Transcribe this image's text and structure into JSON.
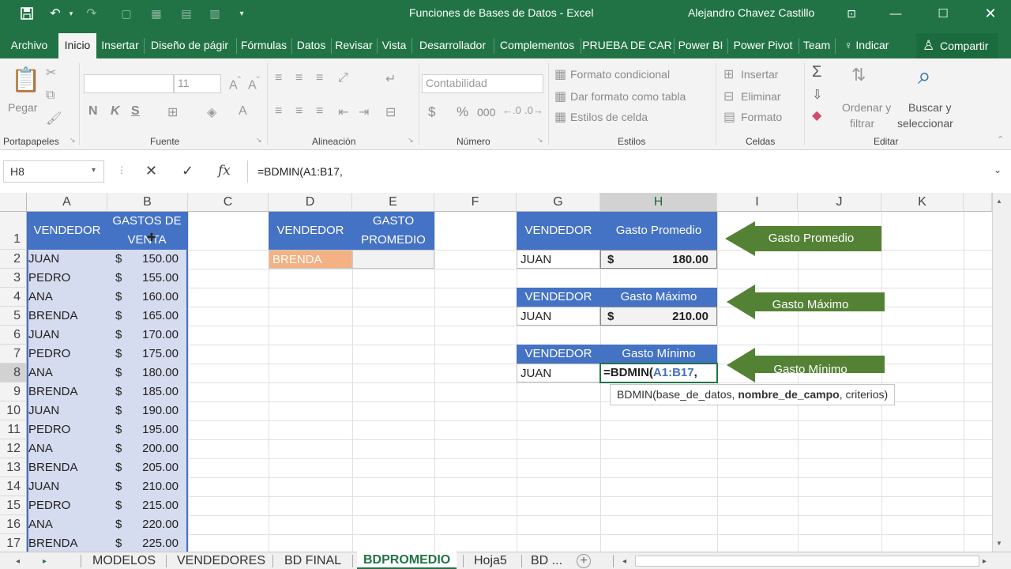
{
  "window": {
    "title": "Funciones de Bases de Datos - Excel",
    "user": "Alejandro Chavez Castillo",
    "accent": "#217346"
  },
  "tabs": [
    "Archivo",
    "Inicio",
    "Insertar",
    "Diseño de págir",
    "Fórmulas",
    "Datos",
    "Revisar",
    "Vista",
    "Desarrollador",
    "Complementos",
    "PRUEBA DE CAR",
    "Power BI",
    "Power Pivot",
    "Team"
  ],
  "tell_me": "Indicar",
  "share": "Compartir",
  "ribbon": {
    "paste": "Pegar",
    "font_size": "11",
    "bold": "N",
    "italic": "K",
    "underline": "S",
    "number_format": "Contabilidad",
    "currency": "$",
    "percent": "%",
    "thousands": "000",
    "conditional": "Formato condicional",
    "as_table": "Dar formato como tabla",
    "cell_styles": "Estilos de celda",
    "insert": "Insertar",
    "delete": "Eliminar",
    "format": "Formato",
    "sort_filter_1": "Ordenar y",
    "sort_filter_2": "filtrar",
    "find_1": "Buscar y",
    "find_2": "seleccionar",
    "groups": {
      "clipboard": "Portapapeles",
      "font": "Fuente",
      "alignment": "Alineación",
      "number": "Número",
      "styles": "Estilos",
      "cells": "Celdas",
      "editing": "Editar"
    }
  },
  "formula_bar": {
    "name_box": "H8",
    "cancel": "✕",
    "enter": "✓",
    "fx": "fx",
    "formula": "=BDMIN(A1:B17,"
  },
  "columns": [
    "A",
    "B",
    "C",
    "D",
    "E",
    "F",
    "G",
    "H",
    "I",
    "J",
    "K"
  ],
  "rows": [
    "1",
    "2",
    "3",
    "4",
    "5",
    "6",
    "7",
    "8",
    "9",
    "10",
    "11",
    "12",
    "13",
    "14",
    "15",
    "16",
    "17"
  ],
  "table": {
    "header_vendedor": "VENDEDOR",
    "header_gastos": "GASTOS DE VENTA",
    "currency": "$",
    "rows": [
      {
        "vendedor": "JUAN",
        "gasto": "150.00"
      },
      {
        "vendedor": "PEDRO",
        "gasto": "155.00"
      },
      {
        "vendedor": "ANA",
        "gasto": "160.00"
      },
      {
        "vendedor": "BRENDA",
        "gasto": "165.00"
      },
      {
        "vendedor": "JUAN",
        "gasto": "170.00"
      },
      {
        "vendedor": "PEDRO",
        "gasto": "175.00"
      },
      {
        "vendedor": "ANA",
        "gasto": "180.00"
      },
      {
        "vendedor": "BRENDA",
        "gasto": "185.00"
      },
      {
        "vendedor": "JUAN",
        "gasto": "190.00"
      },
      {
        "vendedor": "PEDRO",
        "gasto": "195.00"
      },
      {
        "vendedor": "ANA",
        "gasto": "200.00"
      },
      {
        "vendedor": "BRENDA",
        "gasto": "205.00"
      },
      {
        "vendedor": "JUAN",
        "gasto": "210.00"
      },
      {
        "vendedor": "PEDRO",
        "gasto": "215.00"
      },
      {
        "vendedor": "ANA",
        "gasto": "220.00"
      },
      {
        "vendedor": "BRENDA",
        "gasto": "225.00"
      }
    ]
  },
  "criteria_de": {
    "h_vendedor": "VENDEDOR",
    "h_gasto": "GASTO PROMEDIO",
    "vendedor": "BRENDA",
    "vendedor_fill": "#f4b183"
  },
  "blocks": {
    "vendedor_label": "VENDEDOR",
    "promedio_label": "Gasto Promedio",
    "promedio_vendedor": "JUAN",
    "promedio_valor": "180.00",
    "maximo_label": "Gasto Máximo",
    "maximo_vendedor": "JUAN",
    "maximo_valor": "210.00",
    "minimo_label": "Gasto Mínimo",
    "minimo_vendedor": "JUAN",
    "minimo_formula_prefix": "=BDMIN(",
    "minimo_formula_ref": "A1:B17",
    "minimo_formula_suffix": ","
  },
  "arrows": {
    "promedio": "Gasto Promedio",
    "maximo": "Gasto Máximo",
    "minimo": "Gasto Mínimo",
    "color": "#548235"
  },
  "tooltip": {
    "fn": "BDMIN(",
    "arg1": "base_de_datos",
    "sep1": ", ",
    "arg2": "nombre_de_campo",
    "sep2": ", ",
    "arg3": "criterios",
    "close": ")"
  },
  "sheets": [
    "MODELOS",
    "VENDEDORES",
    "BD FINAL",
    "BDPROMEDIO",
    "Hoja5",
    "BD ..."
  ],
  "active_sheet": "BDPROMEDIO"
}
